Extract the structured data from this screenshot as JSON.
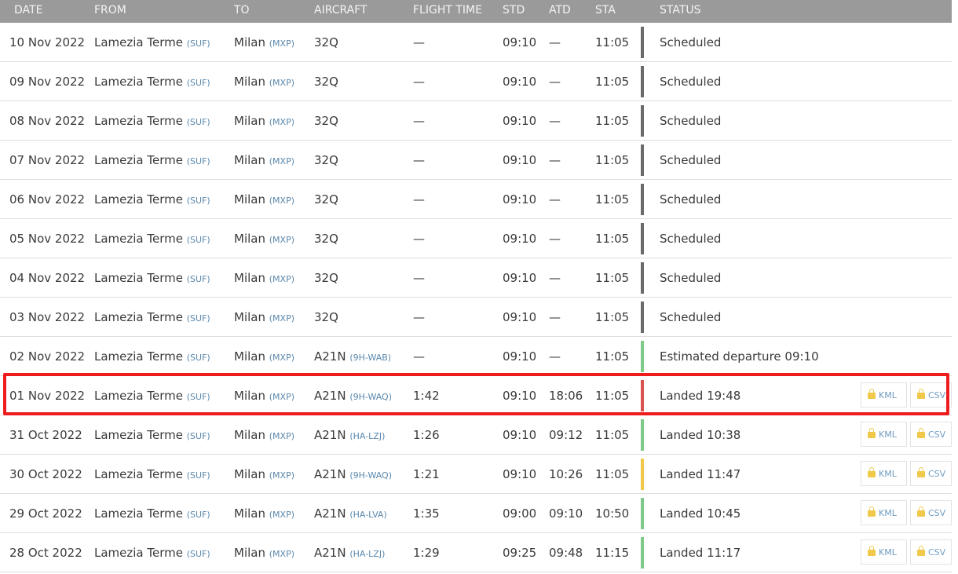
{
  "headers": {
    "date": "DATE",
    "from": "FROM",
    "to": "TO",
    "aircraft": "AIRCRAFT",
    "flight_time": "FLIGHT TIME",
    "std": "STD",
    "atd": "ATD",
    "sta": "STA",
    "status": "STATUS"
  },
  "buttons": {
    "kml": "KML",
    "csv": "CSV"
  },
  "colors": {
    "scheduled": "#6b6b6b",
    "estimated": "#7fc98a",
    "landed_late": "#d9534f",
    "landed_ok": "#7fc98a",
    "landed_warn": "#f0c94a",
    "highlight": "#ee1c1c"
  },
  "rows": [
    {
      "date": "10 Nov 2022",
      "from_city": "Lamezia Terme",
      "from_code": "(SUF)",
      "to_city": "Milan",
      "to_code": "(MXP)",
      "aircraft": "32Q",
      "reg": "",
      "flight_time": "—",
      "std": "09:10",
      "atd": "—",
      "sta": "11:05",
      "status": "Scheduled",
      "bar_color": "#6b6b6b",
      "has_buttons": false
    },
    {
      "date": "09 Nov 2022",
      "from_city": "Lamezia Terme",
      "from_code": "(SUF)",
      "to_city": "Milan",
      "to_code": "(MXP)",
      "aircraft": "32Q",
      "reg": "",
      "flight_time": "—",
      "std": "09:10",
      "atd": "—",
      "sta": "11:05",
      "status": "Scheduled",
      "bar_color": "#6b6b6b",
      "has_buttons": false
    },
    {
      "date": "08 Nov 2022",
      "from_city": "Lamezia Terme",
      "from_code": "(SUF)",
      "to_city": "Milan",
      "to_code": "(MXP)",
      "aircraft": "32Q",
      "reg": "",
      "flight_time": "—",
      "std": "09:10",
      "atd": "—",
      "sta": "11:05",
      "status": "Scheduled",
      "bar_color": "#6b6b6b",
      "has_buttons": false
    },
    {
      "date": "07 Nov 2022",
      "from_city": "Lamezia Terme",
      "from_code": "(SUF)",
      "to_city": "Milan",
      "to_code": "(MXP)",
      "aircraft": "32Q",
      "reg": "",
      "flight_time": "—",
      "std": "09:10",
      "atd": "—",
      "sta": "11:05",
      "status": "Scheduled",
      "bar_color": "#6b6b6b",
      "has_buttons": false
    },
    {
      "date": "06 Nov 2022",
      "from_city": "Lamezia Terme",
      "from_code": "(SUF)",
      "to_city": "Milan",
      "to_code": "(MXP)",
      "aircraft": "32Q",
      "reg": "",
      "flight_time": "—",
      "std": "09:10",
      "atd": "—",
      "sta": "11:05",
      "status": "Scheduled",
      "bar_color": "#6b6b6b",
      "has_buttons": false
    },
    {
      "date": "05 Nov 2022",
      "from_city": "Lamezia Terme",
      "from_code": "(SUF)",
      "to_city": "Milan",
      "to_code": "(MXP)",
      "aircraft": "32Q",
      "reg": "",
      "flight_time": "—",
      "std": "09:10",
      "atd": "—",
      "sta": "11:05",
      "status": "Scheduled",
      "bar_color": "#6b6b6b",
      "has_buttons": false
    },
    {
      "date": "04 Nov 2022",
      "from_city": "Lamezia Terme",
      "from_code": "(SUF)",
      "to_city": "Milan",
      "to_code": "(MXP)",
      "aircraft": "32Q",
      "reg": "",
      "flight_time": "—",
      "std": "09:10",
      "atd": "—",
      "sta": "11:05",
      "status": "Scheduled",
      "bar_color": "#6b6b6b",
      "has_buttons": false
    },
    {
      "date": "03 Nov 2022",
      "from_city": "Lamezia Terme",
      "from_code": "(SUF)",
      "to_city": "Milan",
      "to_code": "(MXP)",
      "aircraft": "32Q",
      "reg": "",
      "flight_time": "—",
      "std": "09:10",
      "atd": "—",
      "sta": "11:05",
      "status": "Scheduled",
      "bar_color": "#6b6b6b",
      "has_buttons": false
    },
    {
      "date": "02 Nov 2022",
      "from_city": "Lamezia Terme",
      "from_code": "(SUF)",
      "to_city": "Milan",
      "to_code": "(MXP)",
      "aircraft": "A21N",
      "reg": "(9H-WAB)",
      "flight_time": "—",
      "std": "09:10",
      "atd": "—",
      "sta": "11:05",
      "status": "Estimated departure 09:10",
      "bar_color": "#7fc98a",
      "has_buttons": false
    },
    {
      "date": "01 Nov 2022",
      "from_city": "Lamezia Terme",
      "from_code": "(SUF)",
      "to_city": "Milan",
      "to_code": "(MXP)",
      "aircraft": "A21N",
      "reg": "(9H-WAQ)",
      "flight_time": "1:42",
      "std": "09:10",
      "atd": "18:06",
      "sta": "11:05",
      "status": "Landed 19:48",
      "bar_color": "#d9534f",
      "has_buttons": true,
      "highlighted": true
    },
    {
      "date": "31 Oct 2022",
      "from_city": "Lamezia Terme",
      "from_code": "(SUF)",
      "to_city": "Milan",
      "to_code": "(MXP)",
      "aircraft": "A21N",
      "reg": "(HA-LZJ)",
      "flight_time": "1:26",
      "std": "09:10",
      "atd": "09:12",
      "sta": "11:05",
      "status": "Landed 10:38",
      "bar_color": "#7fc98a",
      "has_buttons": true
    },
    {
      "date": "30 Oct 2022",
      "from_city": "Lamezia Terme",
      "from_code": "(SUF)",
      "to_city": "Milan",
      "to_code": "(MXP)",
      "aircraft": "A21N",
      "reg": "(9H-WAQ)",
      "flight_time": "1:21",
      "std": "09:10",
      "atd": "10:26",
      "sta": "11:05",
      "status": "Landed 11:47",
      "bar_color": "#f0c94a",
      "has_buttons": true
    },
    {
      "date": "29 Oct 2022",
      "from_city": "Lamezia Terme",
      "from_code": "(SUF)",
      "to_city": "Milan",
      "to_code": "(MXP)",
      "aircraft": "A21N",
      "reg": "(HA-LVA)",
      "flight_time": "1:35",
      "std": "09:00",
      "atd": "09:10",
      "sta": "10:50",
      "status": "Landed 10:45",
      "bar_color": "#7fc98a",
      "has_buttons": true
    },
    {
      "date": "28 Oct 2022",
      "from_city": "Lamezia Terme",
      "from_code": "(SUF)",
      "to_city": "Milan",
      "to_code": "(MXP)",
      "aircraft": "A21N",
      "reg": "(HA-LZJ)",
      "flight_time": "1:29",
      "std": "09:25",
      "atd": "09:48",
      "sta": "11:15",
      "status": "Landed 11:17",
      "bar_color": "#7fc98a",
      "has_buttons": true
    }
  ]
}
